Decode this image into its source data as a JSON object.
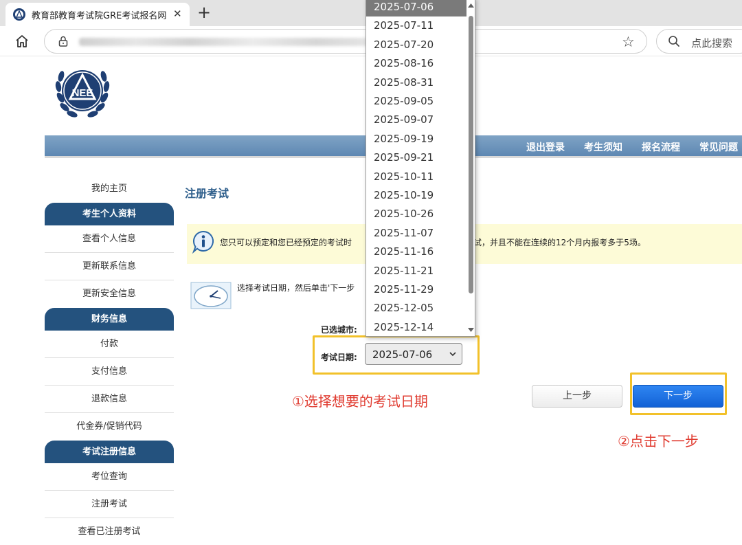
{
  "browser": {
    "tab_title": "教育部教育考试院GRE考试报名网",
    "tab_close": "✕",
    "new_tab": "+",
    "search_placeholder": "点此搜索"
  },
  "nav": {
    "items": [
      "退出登录",
      "考生须知",
      "报名流程",
      "常见问题"
    ]
  },
  "sidebar": {
    "home": "我的主页",
    "sections": [
      {
        "header": "考生个人资料",
        "links": [
          "查看个人信息",
          "更新联系信息",
          "更新安全信息"
        ]
      },
      {
        "header": "财务信息",
        "links": [
          "付款",
          "支付信息",
          "退款信息",
          "代金券/促销代码"
        ]
      },
      {
        "header": "考试注册信息",
        "links": [
          "考位查询",
          "注册考试",
          "查看已注册考试"
        ]
      }
    ]
  },
  "main": {
    "title": "注册考试",
    "notice_left": "您只可以预定和您已经预定的考试时",
    "notice_right": "试，并且不能在连续的12个月内报考多于5场。",
    "instruction": "选择考试日期，然后单击'下一步",
    "label_city": "已选城市:",
    "label_date": "考试日期:",
    "selected_date": "2025-07-06",
    "prev_button": "上一步",
    "next_button": "下一步"
  },
  "dropdown": {
    "options": [
      "2025-07-06",
      "2025-07-11",
      "2025-07-20",
      "2025-08-16",
      "2025-08-31",
      "2025-09-05",
      "2025-09-07",
      "2025-09-19",
      "2025-09-21",
      "2025-10-11",
      "2025-10-19",
      "2025-10-26",
      "2025-11-07",
      "2025-11-16",
      "2025-11-21",
      "2025-11-29",
      "2025-12-05",
      "2025-12-14"
    ],
    "selected_index": 0
  },
  "annotations": {
    "step1": "①选择想要的考试日期",
    "step2": "②点击下一步"
  },
  "colors": {
    "nav_bar": "#6d95bd",
    "sidebar_header": "#24527e",
    "notice_bg": "#fdfbd7",
    "highlight": "#f2c12a",
    "annotation": "#e03c31",
    "next_button": "#1e73e6"
  },
  "icons": {
    "favicon": "nee-logo-icon",
    "home": "home-icon",
    "lock": "lock-icon",
    "star": "star-icon",
    "search": "search-icon",
    "info": "info-icon",
    "clock": "clock-icon"
  }
}
